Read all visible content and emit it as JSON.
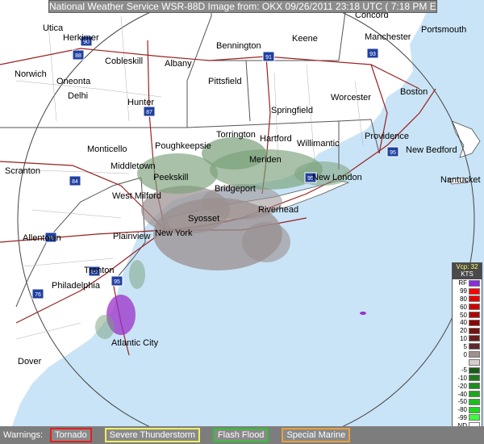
{
  "header": {
    "title": "National Weather Service WSR-88D Image from: OKX 09/26/2011 23:18 UTC ( 7:18 PM EDT)"
  },
  "colors": {
    "ocean": "#c9e4f6",
    "land": "#ffffff",
    "radar_gray": "#9a8f8f",
    "radar_green": "#7aa07a",
    "highway": "#9b2020",
    "state_border": "#555555",
    "purple": "#9b30c8"
  },
  "map": {
    "cities": [
      {
        "name": "Utica"
      },
      {
        "name": "Herkimer"
      },
      {
        "name": "Cobleskill"
      },
      {
        "name": "Albany"
      },
      {
        "name": "Bennington"
      },
      {
        "name": "Keene"
      },
      {
        "name": "Concord"
      },
      {
        "name": "Manchester"
      },
      {
        "name": "Portsmouth"
      },
      {
        "name": "Norwich"
      },
      {
        "name": "Oneonta"
      },
      {
        "name": "Delhi"
      },
      {
        "name": "Hunter"
      },
      {
        "name": "Pittsfield"
      },
      {
        "name": "Springfield"
      },
      {
        "name": "Worcester"
      },
      {
        "name": "Boston"
      },
      {
        "name": "Torrington"
      },
      {
        "name": "Hartford"
      },
      {
        "name": "Willimantic"
      },
      {
        "name": "Providence"
      },
      {
        "name": "New Bedford"
      },
      {
        "name": "Monticello"
      },
      {
        "name": "Poughkeepsie"
      },
      {
        "name": "Middletown"
      },
      {
        "name": "Meriden"
      },
      {
        "name": "New London"
      },
      {
        "name": "Nantucket"
      },
      {
        "name": "Scranton"
      },
      {
        "name": "Peekskill"
      },
      {
        "name": "Bridgeport"
      },
      {
        "name": "West Milford"
      },
      {
        "name": "Syosset"
      },
      {
        "name": "Riverhead"
      },
      {
        "name": "Allentown"
      },
      {
        "name": "Plainview"
      },
      {
        "name": "New York"
      },
      {
        "name": "Trenton"
      },
      {
        "name": "Philadelphia"
      },
      {
        "name": "Atlantic City"
      },
      {
        "name": "Dover"
      }
    ],
    "highway_shields": [
      {
        "label": "90"
      },
      {
        "label": "88"
      },
      {
        "label": "87"
      },
      {
        "label": "91"
      },
      {
        "label": "93"
      },
      {
        "label": "84"
      },
      {
        "label": "95"
      },
      {
        "label": "80"
      },
      {
        "label": "78"
      },
      {
        "label": "76"
      },
      {
        "label": "95"
      },
      {
        "label": "95"
      }
    ]
  },
  "legend": {
    "vcp_label": "Vcp: 32",
    "units": "KTS",
    "entries": [
      {
        "label": "RF",
        "color": "#8a2be2"
      },
      {
        "label": "99",
        "color": "#ff0000"
      },
      {
        "label": "80",
        "color": "#e80000"
      },
      {
        "label": "60",
        "color": "#d00000"
      },
      {
        "label": "50",
        "color": "#b00000"
      },
      {
        "label": "40",
        "color": "#900000"
      },
      {
        "label": "20",
        "color": "#7a1010"
      },
      {
        "label": "10",
        "color": "#6b1b1b"
      },
      {
        "label": "5",
        "color": "#5c2a2a"
      },
      {
        "label": "0",
        "color": "#a09090"
      },
      {
        "label": "",
        "color": "#d8cccc"
      },
      {
        "label": "-5",
        "color": "#1a5a1a"
      },
      {
        "label": "-10",
        "color": "#1e7a1e"
      },
      {
        "label": "-20",
        "color": "#1a8f1a"
      },
      {
        "label": "-40",
        "color": "#1aa81a"
      },
      {
        "label": "-50",
        "color": "#1ac01a"
      },
      {
        "label": "-80",
        "color": "#1ad81a"
      },
      {
        "label": "-99",
        "color": "#3aff3a"
      },
      {
        "label": "ND",
        "color": "#ffffff"
      }
    ]
  },
  "warnings": {
    "label": "Warnings:",
    "items": [
      {
        "label": "Tornado",
        "color": "#e02020"
      },
      {
        "label": "Severe Thunderstorm",
        "color": "#f0f060"
      },
      {
        "label": "Flash Flood",
        "color": "#30c030"
      },
      {
        "label": "Special Marine",
        "color": "#e8a040"
      }
    ]
  }
}
